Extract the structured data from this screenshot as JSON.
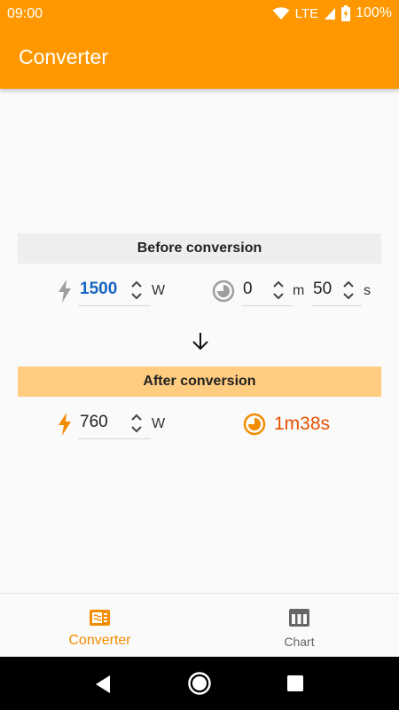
{
  "status_bar": {
    "time": "09:00",
    "network": "LTE",
    "battery": "100%"
  },
  "app_bar": {
    "title": "Converter"
  },
  "before": {
    "header": "Before conversion",
    "power_value": "1500",
    "power_unit": "W",
    "minutes_value": "0",
    "minutes_unit": "m",
    "seconds_value": "50",
    "seconds_unit": "s"
  },
  "after": {
    "header": "After conversion",
    "power_value": "760",
    "power_unit": "W",
    "result_time": "1m38s"
  },
  "bottom_nav": {
    "items": [
      {
        "label": "Converter",
        "icon": "converter-icon",
        "active": true
      },
      {
        "label": "Chart",
        "icon": "chart-table-icon",
        "active": false
      }
    ]
  },
  "colors": {
    "primary": "#ff9800",
    "active_nav": "#f28c00",
    "blue_value": "#1565c0",
    "result": "#e65100",
    "after_header_bg": "#ffcc80"
  }
}
